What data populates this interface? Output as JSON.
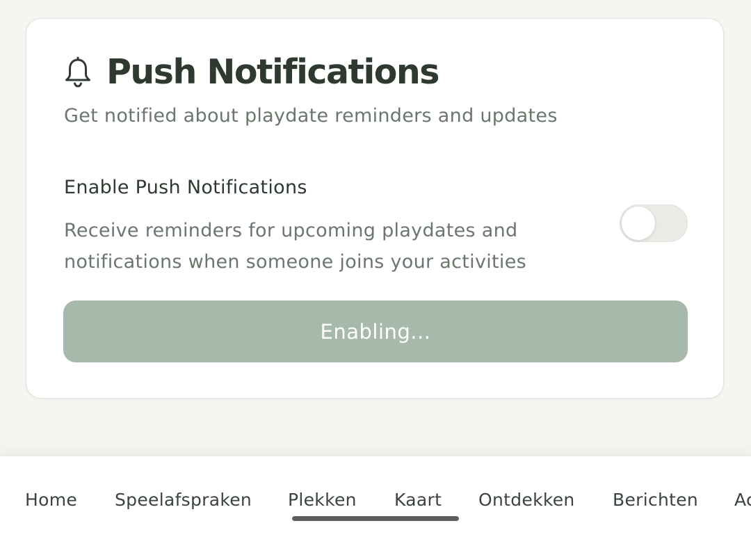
{
  "card": {
    "icon": "bell-icon",
    "title": "Push Notifications",
    "subtitle": "Get notified about playdate reminders and updates",
    "setting": {
      "label": "Enable Push Notifications",
      "description": "Receive reminders for upcoming playdates and notifications when someone joins your activities",
      "enabled": false
    },
    "button_label": "Enabling..."
  },
  "bottom_nav": {
    "items": [
      {
        "label": "Home"
      },
      {
        "label": "Speelafspraken"
      },
      {
        "label": "Plekken"
      },
      {
        "label": "Kaart"
      },
      {
        "label": "Ontdekken"
      },
      {
        "label": "Berichten"
      },
      {
        "label": "Ac"
      }
    ]
  },
  "colors": {
    "title": "#2e3a2f",
    "muted_text": "#6b766c",
    "button_bg": "#a7b9aa",
    "page_bg": "#f6f5f1"
  }
}
